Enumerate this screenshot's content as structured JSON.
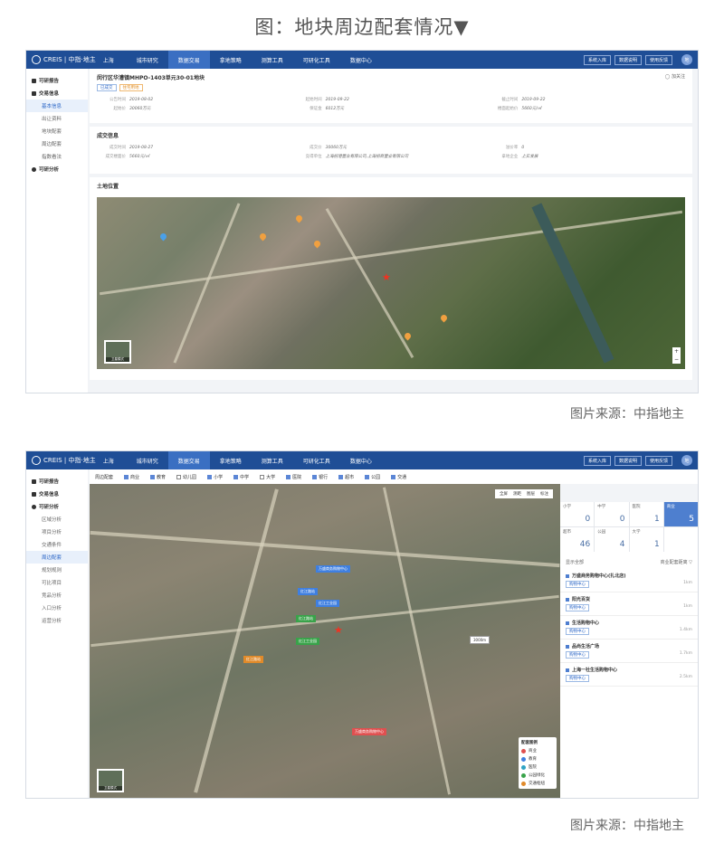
{
  "caption": "图：地块周边配套情况▼",
  "source": "图片来源：中指地主",
  "app": {
    "logo_text": "CREIS | 中指·地主",
    "city": "上海",
    "nav": [
      "城市研究",
      "数据交易",
      "拿地策略",
      "测算工具",
      "可研化工具",
      "数据中心"
    ],
    "top_buttons": [
      "系统入库",
      "数据说明",
      "使用反馈"
    ],
    "avatar": "地"
  },
  "screen1": {
    "sidebar": [
      {
        "label": "可研报告",
        "children": []
      },
      {
        "label": "交易信息",
        "children": [
          "基本信息",
          "出让资料",
          "地块配套",
          "周边配套",
          "指数看法"
        ]
      },
      {
        "label": "可研分析",
        "children": []
      }
    ],
    "parcel_title": "闵行区华漕镇MHPO-1403单元30-01地块",
    "tags": [
      "已成交",
      "住宅用地"
    ],
    "follow": "加关注",
    "info_rows": [
      {
        "k": "公告时间",
        "v": "2019-08-02"
      },
      {
        "k": "起始时间",
        "v": "2019-09-22"
      },
      {
        "k": "截止时间",
        "v": "2019-09-22"
      },
      {
        "k": "起始价",
        "v": "30060万元"
      },
      {
        "k": "保证金",
        "v": "6012万元"
      },
      {
        "k": "楼面起始价",
        "v": "5660元/㎡"
      }
    ],
    "deal_title": "成交信息",
    "deal_rows": [
      {
        "k": "成交时间",
        "v": "2019-08-27"
      },
      {
        "k": "成交价",
        "v": "30060万元"
      },
      {
        "k": "溢价率",
        "v": "0"
      },
      {
        "k": "成交楼面价",
        "v": "5660元/㎡"
      },
      {
        "k": "竞得单位",
        "v": "上海招港置业有限公司,上海招商置业有限公司"
      },
      {
        "k": "拿地企业",
        "v": "上实发展"
      }
    ],
    "location_title": "土地位置",
    "thumb_label": "卫星模式"
  },
  "screen2": {
    "sidebar": [
      {
        "label": "可研报告",
        "children": []
      },
      {
        "label": "交易信息",
        "children": []
      },
      {
        "label": "可研分析",
        "children": [
          "区域分析",
          "项目分析",
          "交通条件",
          "周边配套",
          "规划规则",
          "可比项目",
          "竞品分析",
          "入口分析",
          "运营分析"
        ]
      }
    ],
    "filter_label": "周边配套",
    "filters": [
      {
        "label": "商业",
        "on": true
      },
      {
        "label": "教育",
        "on": true
      },
      {
        "label": "幼儿园",
        "on": false
      },
      {
        "label": "小学",
        "on": true
      },
      {
        "label": "中学",
        "on": true
      },
      {
        "label": "大学",
        "on": false
      },
      {
        "label": "医院",
        "on": true
      },
      {
        "label": "银行",
        "on": true
      },
      {
        "label": "超市",
        "on": true
      },
      {
        "label": "公园",
        "on": true
      },
      {
        "label": "交通",
        "on": true
      }
    ],
    "map_tools": [
      "全屏",
      "测距",
      "图层",
      "标注"
    ],
    "stats": [
      {
        "k": "小学",
        "v": "0"
      },
      {
        "k": "中学",
        "v": "0"
      },
      {
        "k": "医院",
        "v": "1"
      },
      {
        "k": "商业",
        "v": "5",
        "sel": true
      },
      {
        "k": "超市",
        "v": "46"
      },
      {
        "k": "公园",
        "v": "4"
      },
      {
        "k": "大学",
        "v": "1"
      }
    ],
    "list_header_left": "显示全部",
    "list_header_right": "商业配套距离 ▽",
    "poi": [
      {
        "name": "万盛商务购物中心(扎北店)",
        "tag": "购物中心",
        "dist": "1km"
      },
      {
        "name": "阳光百货",
        "tag": "购物中心",
        "dist": "1km"
      },
      {
        "name": "生活购物中心",
        "tag": "购物中心",
        "dist": "1.4km"
      },
      {
        "name": "品尚生活广场",
        "tag": "购物中心",
        "dist": "1.7km"
      },
      {
        "name": "上海一社生活购物中心",
        "tag": "购物中心",
        "dist": "2.5km"
      }
    ],
    "legend_title": "配套图例",
    "legend": [
      {
        "label": "商业",
        "color": "#e04f4f"
      },
      {
        "label": "教育",
        "color": "#3f7fe0"
      },
      {
        "label": "医院",
        "color": "#2fa3c4"
      },
      {
        "label": "公园绿化",
        "color": "#39a34a"
      },
      {
        "label": "交通枢纽",
        "color": "#e08a2a"
      }
    ],
    "map_labels": [
      "红江路站",
      "红江工业园",
      "红江路站",
      "红江工业园",
      "万盛商务购物中心"
    ],
    "distance_label": "3000m",
    "thumb_label": "卫星模式"
  }
}
